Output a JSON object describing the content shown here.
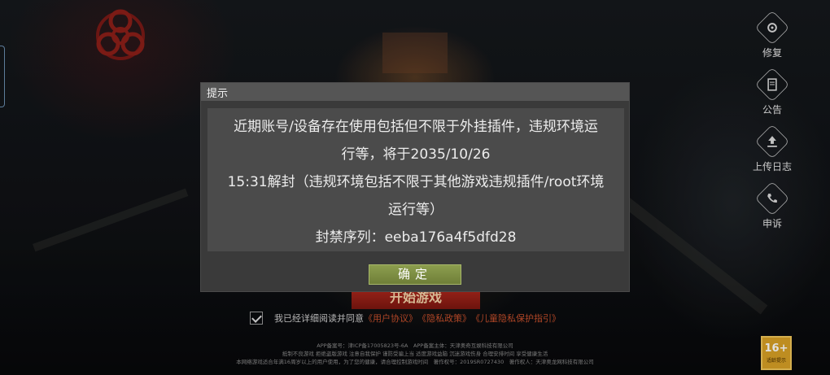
{
  "side_menu": [
    {
      "id": "repair",
      "label": "修复",
      "icon": "gear-icon"
    },
    {
      "id": "notice",
      "label": "公告",
      "icon": "document-icon"
    },
    {
      "id": "upload",
      "label": "上传日志",
      "icon": "upload-icon"
    },
    {
      "id": "appeal",
      "label": "申诉",
      "icon": "phone-icon"
    }
  ],
  "start_button": "开始游戏",
  "agreement": {
    "text": "我已经详细阅读并同意",
    "links": [
      "《用户协议》",
      "《隐私政策》",
      "《儿童隐私保护指引》"
    ]
  },
  "footer_lines": [
    "APP备案号：津ICP备17005823号-6A　APP备案主体：天津奥奇互娱科技有限公司",
    "抵制不良游戏 拒绝盗版游戏 注意自我保护 谨防受骗上当 适度游戏益脑 沉迷游戏伤身 合理安排时间 享受健康生活",
    "本网络游戏适合年满16周岁以上的用户使用，为了您的健康，请合理控制游戏时间　著作权号：2019SR0727430　著作权人：天津奥龙网科技有限公司"
  ],
  "age_rating": {
    "label": "16+",
    "caption": "适龄提示"
  },
  "dialog": {
    "title": "提示",
    "lines": [
      "近期账号/设备存在使用包括但不限于外挂插件，违规环境运",
      "行等，将于2035/10/26",
      "15:31解封（违规环境包括不限于其他游戏违规插件/root环境",
      "运行等）",
      "封禁序列：eeba176a4f5dfd28"
    ],
    "confirm_label": "确定"
  },
  "colors": {
    "accent_red": "#b42a1e",
    "link": "#c8502c",
    "confirm_green": "#8c9e4e",
    "age_badge": "#d9a126"
  }
}
